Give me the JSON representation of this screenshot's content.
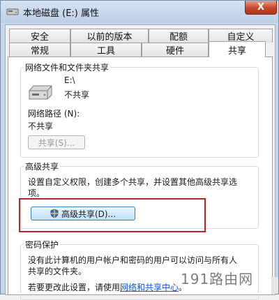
{
  "window": {
    "title": "本地磁盘 (E:) 属性",
    "close_glyph": "X"
  },
  "tabs": {
    "row1": [
      "安全",
      "以前的版本",
      "配额",
      "自定义"
    ],
    "row2": [
      "常规",
      "工具",
      "硬件",
      "共享"
    ],
    "active": "共享"
  },
  "network_sharing": {
    "title": "网络文件和文件夹共享",
    "drive_path": "E:\\",
    "drive_status": "不共享",
    "network_path_label": "网络路径 (N):",
    "network_path_value": "不共享",
    "share_button": "共享(S)..."
  },
  "advanced_sharing": {
    "title": "高级共享",
    "description_line1": "设置自定义权限，创建多个共享，并设置其他高级共享选",
    "description_line2": "项。",
    "button": "高级共享(D)..."
  },
  "password_protection": {
    "title": "密码保护",
    "line1": "没有此计算机的用户帐户和密码的用户可以访问与所有人",
    "line2": "共享的文件夹。",
    "line3_prefix": "若要更改此设置，请使用",
    "line3_link": "网络和共享中心",
    "line3_suffix": "。"
  },
  "watermark": "191路由网",
  "icons": {
    "drive": "drive-icon",
    "shield": "uac-shield-icon",
    "window": "drive-window-icon"
  },
  "colors": {
    "highlight": "#b3262a",
    "link": "#1155cc"
  }
}
